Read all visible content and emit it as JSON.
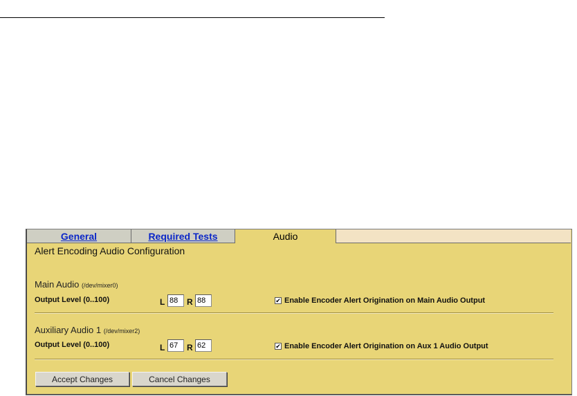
{
  "tabs": [
    {
      "label": "General",
      "active": false
    },
    {
      "label": "Required Tests",
      "active": false
    },
    {
      "label": "Audio",
      "active": true
    }
  ],
  "heading": "Alert Encoding Audio Configuration",
  "main_audio": {
    "title": "Main Audio",
    "device": "(/dev/mixer0)",
    "output_label": "Output Level (0..100)",
    "left_label": "L",
    "right_label": "R",
    "left_value": "88",
    "right_value": "88",
    "checkbox_label": "Enable Encoder Alert Origination on Main Audio Output",
    "checked": true
  },
  "aux_audio": {
    "title": "Auxiliary Audio 1",
    "device": "(/dev/mixer2)",
    "output_label": "Output Level (0..100)",
    "left_label": "L",
    "right_label": "R",
    "left_value": "67",
    "right_value": "62",
    "checkbox_label": "Enable Encoder Alert Origination on Aux 1 Audio Output",
    "checked": true
  },
  "buttons": {
    "accept": "Accept Changes",
    "cancel": "Cancel Changes"
  },
  "colors": {
    "panel_bg": "#e8d577",
    "tab_inactive": "#cfcfc3",
    "tab_link": "#0a26c8",
    "tab_filler": "#f3e3c4"
  }
}
